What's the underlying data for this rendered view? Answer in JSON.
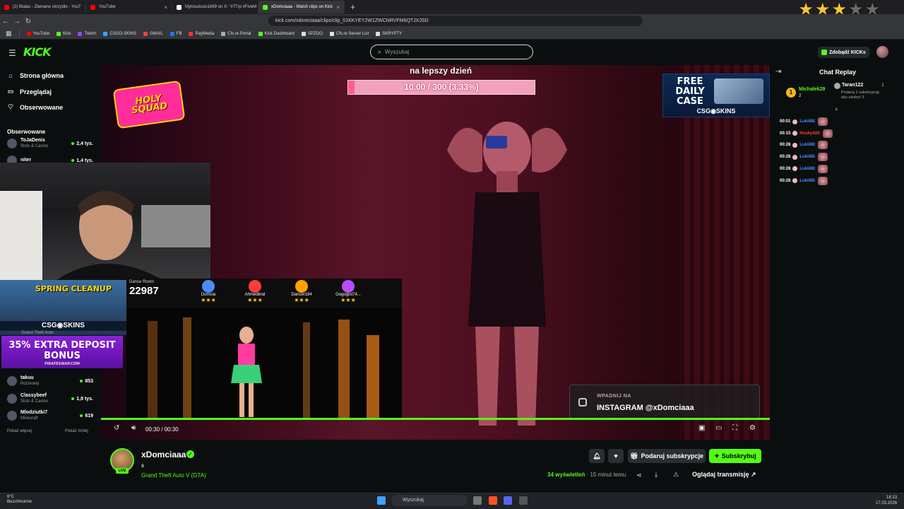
{
  "browser": {
    "tabs": [
      {
        "label": "(2) Bialas - Złamane skrzydło - YouT",
        "color": "#ff0000"
      },
      {
        "label": "YouTube",
        "color": "#ff0000"
      },
      {
        "label": "Mytosukces1669 on X: \"#77rp #FiveM",
        "color": "#ffffff"
      },
      {
        "label": "xDomciaaa - Watch clips on Kick",
        "color": "#53fc18",
        "active": true
      }
    ],
    "url": "kick.com/xdomciaaa/clips/clip_01KKYEY2W1ZWCNRVFM6QTJXJSD",
    "bookmarks": [
      "YouTube",
      "Kick",
      "Twitch",
      "CSGO-SKINS",
      "GMAIL",
      "FB",
      "PayMedia",
      "Cfx.re Portal",
      "Kick Dashboard",
      "SPZOO",
      "Cfx.re Server List",
      "SKRYPTY"
    ],
    "rating_stars": {
      "filled": 3,
      "total": 5
    }
  },
  "header": {
    "logo": "KICK",
    "search_placeholder": "Wyszukaj",
    "kicks_button": "Zdobądź KICKs"
  },
  "sidebar": {
    "nav": [
      {
        "label": "Strona główna",
        "icon": "home-icon"
      },
      {
        "label": "Przeglądaj",
        "icon": "browse-icon"
      },
      {
        "label": "Obserwowane",
        "icon": "heart-icon"
      }
    ],
    "followed_title": "Obserwowane",
    "channels_top": [
      {
        "name": "ToJaDenis",
        "category": "Slots & Casino",
        "viewers": "2,4 tys."
      },
      {
        "name": "niter",
        "category": "",
        "viewers": "1,4 tys."
      }
    ],
    "channels_bottom": [
      {
        "name": "takuu",
        "category": "Rozmowy",
        "viewers": "853"
      },
      {
        "name": "Classybeef",
        "category": "Slots & Casino",
        "viewers": "1,8 tys."
      },
      {
        "name": "Mlodziutki7",
        "category": "Minecraft",
        "viewers": "619"
      }
    ],
    "show_more": "Pokaż więcej",
    "show_less": "Pokaż mniej"
  },
  "video": {
    "goal_label": "na lepszy dzień",
    "goal_text": "10.00 / 300 (3.33%)",
    "goal_fraction": 0.0333,
    "holy_squad": "HOLY SQUAD",
    "daily_case_title": "FREE DAILY CASE",
    "daily_case_brand": "CSG◉SKINS",
    "spring_title": "SPRING CLEANUP",
    "spring_brand": "CSG◉SKINS",
    "spring_sub": "Grand Theft Auto",
    "bonus_text": "35% EXTRA DEPOSIT BONUS",
    "bonus_site": "PIRATESWAP.COM",
    "dance_room_label": "Dance Room",
    "dance_score": "22987",
    "players": [
      {
        "name": "Domcia",
        "stars": "★★★",
        "color": "#4a8cff"
      },
      {
        "name": "Ahmedkral",
        "stars": "★★★",
        "color": "#ff3b3b"
      },
      {
        "name": "Dancer184",
        "stars": "★★★",
        "color": "#ffa200"
      },
      {
        "name": "Gogogist74...",
        "stars": "★★★",
        "color": "#b84dff"
      }
    ],
    "instagram_label": "WPADNIJ NA",
    "instagram_handle": "INSTAGRAM @xDomciaaa",
    "time": "00:30 / 00:30",
    "progress_fraction": 1.0
  },
  "channel": {
    "name": "xDomciaaa",
    "live_badge": "LIVE",
    "clip_title": "s",
    "category": "Grand Theft Auto V (GTA)",
    "gift_sub": "Podaruj subskrypcje",
    "subscribe": "Subskrybuj",
    "views_count": "34",
    "views_label": "wyświetleń",
    "time_ago": "· 15 minut temu",
    "watch_stream": "Oglądaj transmisję"
  },
  "chat": {
    "title": "Chat Replay",
    "top_gifter": {
      "rank": "1",
      "name": "Michalek29",
      "count": "2"
    },
    "pinned": {
      "name": "Taran122",
      "count": "1",
      "text": "Podaruj 1 subskrypcję, aby zdobyć 3."
    },
    "messages": [
      {
        "time": "00:01",
        "user": "Lukii88:",
        "color": "#4a8cff"
      },
      {
        "time": "00:15",
        "user": "Husky420:",
        "color": "#ff3b3b"
      },
      {
        "time": "00:28",
        "user": "Lukii88:",
        "color": "#4a8cff"
      },
      {
        "time": "00:28",
        "user": "Lukii88:",
        "color": "#4a8cff"
      },
      {
        "time": "00:28",
        "user": "Lukii88:",
        "color": "#4a8cff"
      },
      {
        "time": "00:28",
        "user": "Lukii88:",
        "color": "#4a8cff"
      }
    ]
  },
  "taskbar": {
    "weather_temp": "6°C",
    "weather_desc": "Bezchmurnie",
    "search": "Wyszukaj",
    "time": "18:13",
    "date": "17.03.2026"
  }
}
